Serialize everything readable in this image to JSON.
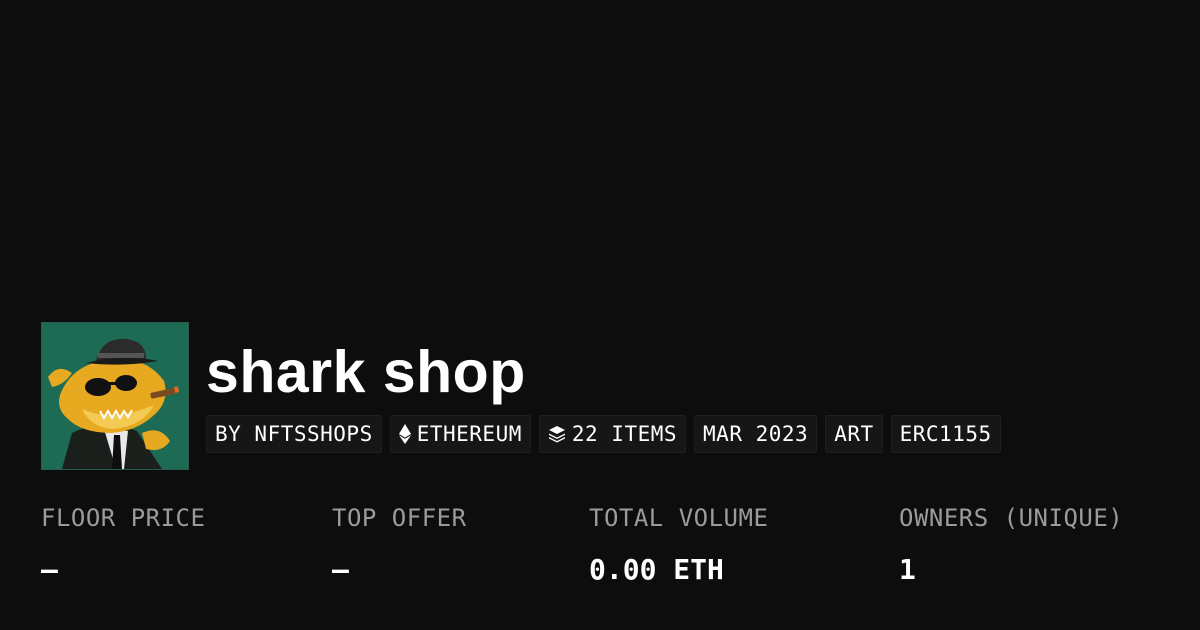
{
  "collection": {
    "name": "shark shop",
    "avatar_icon": "shark-avatar-icon"
  },
  "tags": [
    {
      "label": "BY NFTSSHOPS",
      "icon": null
    },
    {
      "label": "ETHEREUM",
      "icon": "ethereum-icon"
    },
    {
      "label": "22 ITEMS",
      "icon": "layers-icon"
    },
    {
      "label": "MAR 2023",
      "icon": null
    },
    {
      "label": "ART",
      "icon": null
    },
    {
      "label": "ERC1155",
      "icon": null
    }
  ],
  "stats": [
    {
      "label": "FLOOR PRICE",
      "value": "–"
    },
    {
      "label": "TOP OFFER",
      "value": "–"
    },
    {
      "label": "TOTAL VOLUME",
      "value": "0.00 ETH"
    },
    {
      "label": "OWNERS (UNIQUE)",
      "value": "1"
    }
  ],
  "colors": {
    "background": "#0d0d0d",
    "tag_background": "#161616",
    "label_gray": "#9b9b9b",
    "avatar_green": "#1d6b55",
    "shark_gold": "#e6a920"
  }
}
